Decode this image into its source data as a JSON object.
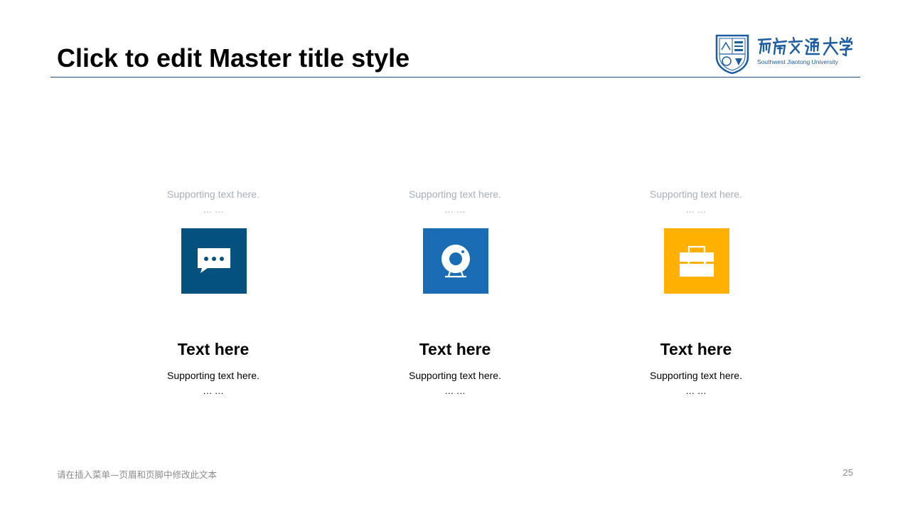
{
  "slide": {
    "title": "Click to edit Master title style",
    "footer": "请在插入菜单—页眉和页脚中修改此文本",
    "page_number": "25"
  },
  "logo": {
    "chinese_name": "西南交通大学",
    "english_name": "Southwest Jiaotong University",
    "color": "#1d5ea3"
  },
  "columns": [
    {
      "top_support": "Supporting  text here.",
      "top_ellipsis": "… …",
      "icon": "chat-bubble-icon",
      "tile_color": "#04507f",
      "heading": "Text here",
      "support": "Supporting  text here.",
      "ellipsis": "… …"
    },
    {
      "top_support": "Supporting  text here.",
      "top_ellipsis": "… …",
      "icon": "webcam-icon",
      "tile_color": "#1a6db5",
      "heading": "Text here",
      "support": "Supporting  text here.",
      "ellipsis": "… …"
    },
    {
      "top_support": "Supporting  text here.",
      "top_ellipsis": "… …",
      "icon": "toolbox-icon",
      "tile_color": "#ffb000",
      "heading": "Text here",
      "support": "Supporting  text here.",
      "ellipsis": "… …"
    }
  ],
  "colors": {
    "title_rule": "#1a4d80",
    "muted_text": "#a6aeb8",
    "footer_text": "#8c8c8c"
  }
}
